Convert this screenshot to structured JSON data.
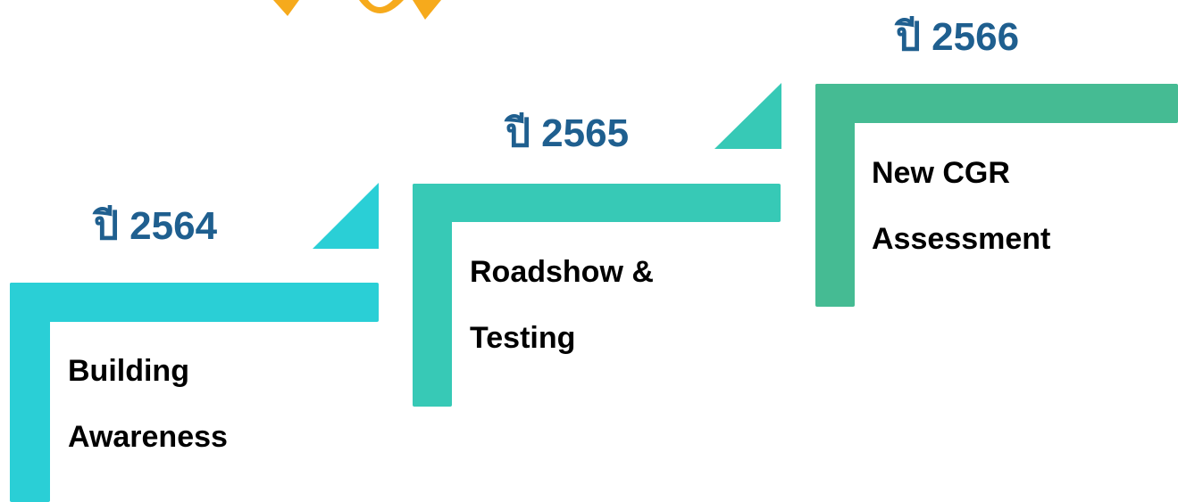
{
  "colors": {
    "step1": "#2acfd6",
    "step2": "#37c9b6",
    "step3": "#45bb93",
    "year_text": "#1f5f8f",
    "body_text": "#000000",
    "sun": "#f6aa1c"
  },
  "steps": [
    {
      "year": "ปี 2564",
      "lines": [
        "Building",
        "Awareness"
      ]
    },
    {
      "year": "ปี 2565",
      "lines": [
        "Roadshow &",
        "Testing"
      ]
    },
    {
      "year": "ปี 2566",
      "lines": [
        "New CGR",
        "Assessment"
      ]
    }
  ]
}
